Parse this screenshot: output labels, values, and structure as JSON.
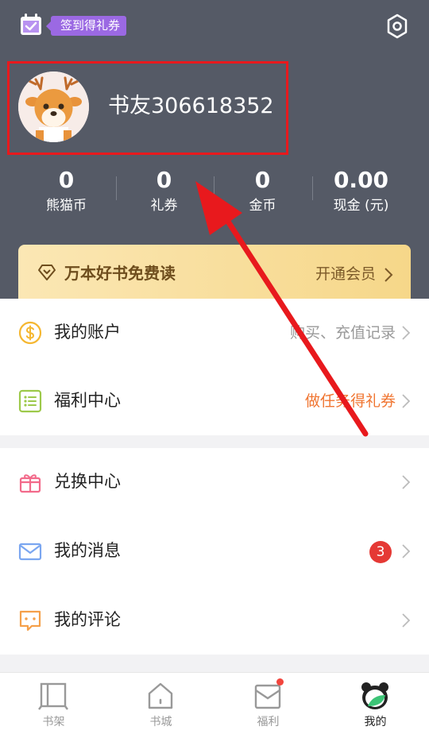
{
  "header": {
    "checkin_badge": "签到得礼券",
    "username": "书友306618352"
  },
  "stats": [
    {
      "value": "0",
      "label": "熊猫币"
    },
    {
      "value": "0",
      "label": "礼券"
    },
    {
      "value": "0",
      "label": "金币"
    },
    {
      "value": "0.00",
      "label": "现金 (元)"
    }
  ],
  "vip": {
    "title": "万本好书免费读",
    "action": "开通会员"
  },
  "menu": {
    "account": {
      "label": "我的账户",
      "right": "购买、充值记录"
    },
    "welfare": {
      "label": "福利中心",
      "right": "做任务得礼券"
    },
    "exchange": {
      "label": "兑换中心"
    },
    "messages": {
      "label": "我的消息",
      "badge": "3"
    },
    "comments": {
      "label": "我的评论"
    }
  },
  "tabs": [
    {
      "label": "书架",
      "icon": "bookshelf-icon"
    },
    {
      "label": "书城",
      "icon": "store-icon"
    },
    {
      "label": "福利",
      "icon": "welfare-icon"
    },
    {
      "label": "我的",
      "icon": "panda-icon"
    }
  ],
  "colors": {
    "header_bg": "#555a66",
    "accent_orange": "#f07531",
    "badge_red": "#e53935",
    "highlight_red": "#e8191d",
    "purple_badge": "#9b69e3"
  }
}
